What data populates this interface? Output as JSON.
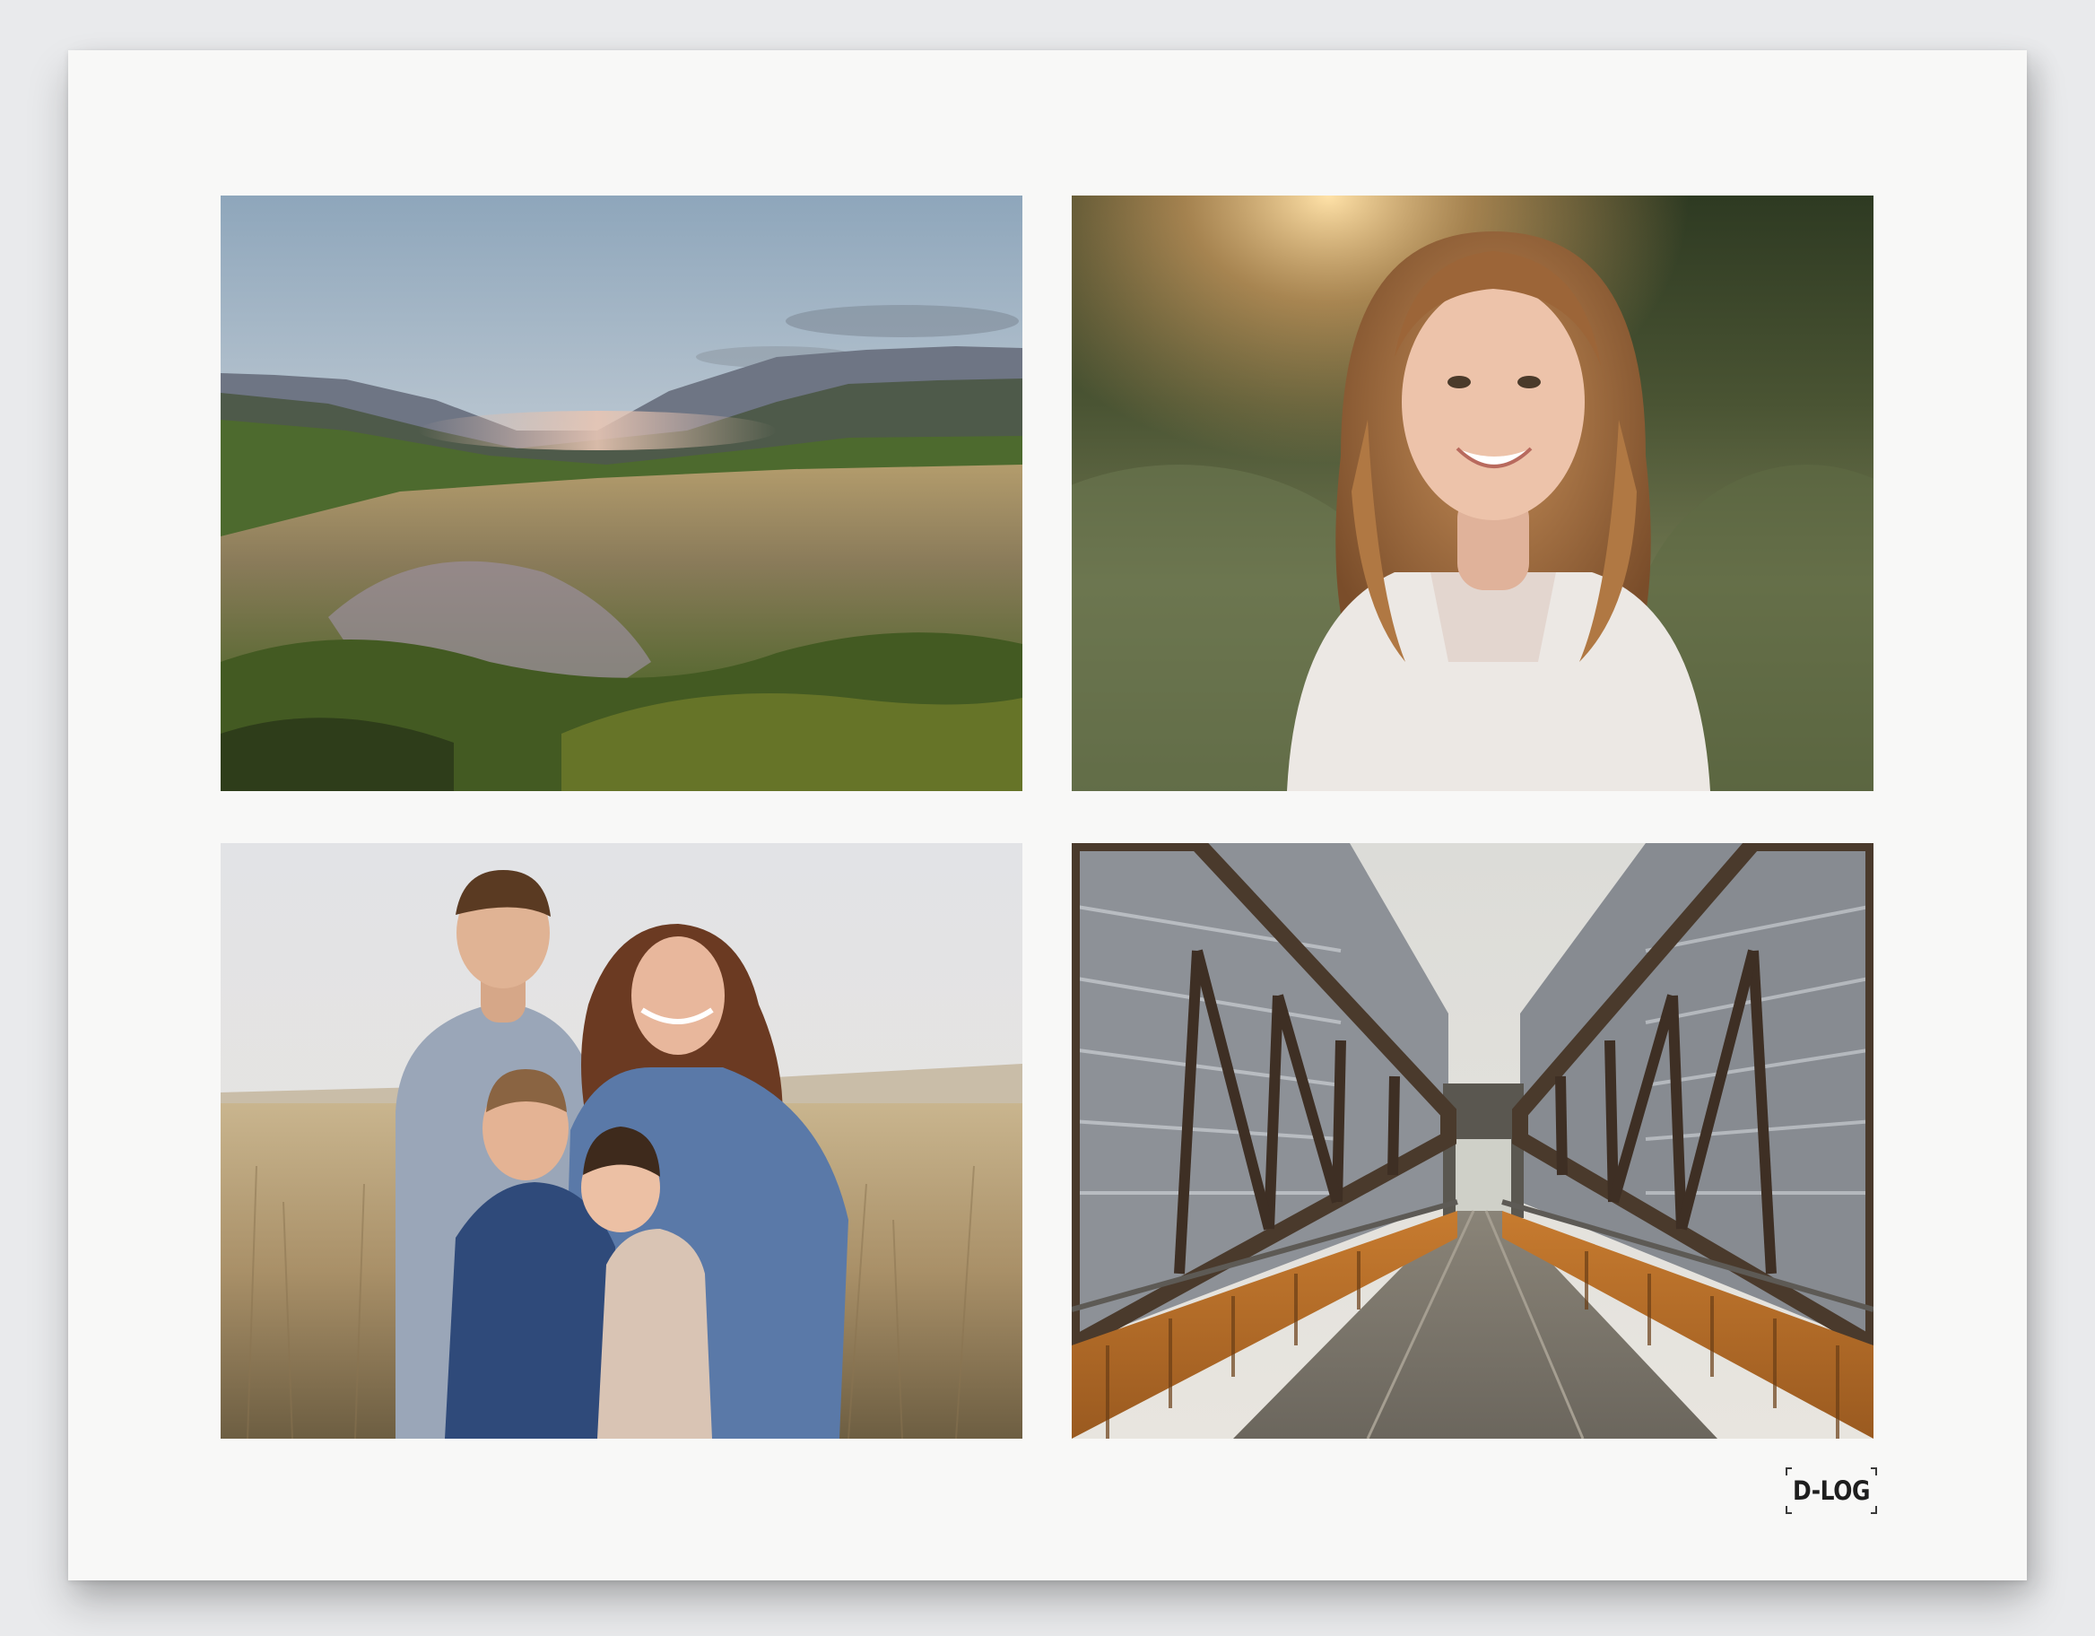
{
  "collage": {
    "photos": [
      {
        "subject": "landscape-valley"
      },
      {
        "subject": "portrait-woman"
      },
      {
        "subject": "family-portrait"
      },
      {
        "subject": "steel-bridge-walkway"
      }
    ]
  },
  "logo": {
    "text": "D-LOG"
  },
  "colors": {
    "background": "#e9eaec",
    "sheet": "#f8f8f7",
    "logo_text": "#1e1e1e"
  }
}
